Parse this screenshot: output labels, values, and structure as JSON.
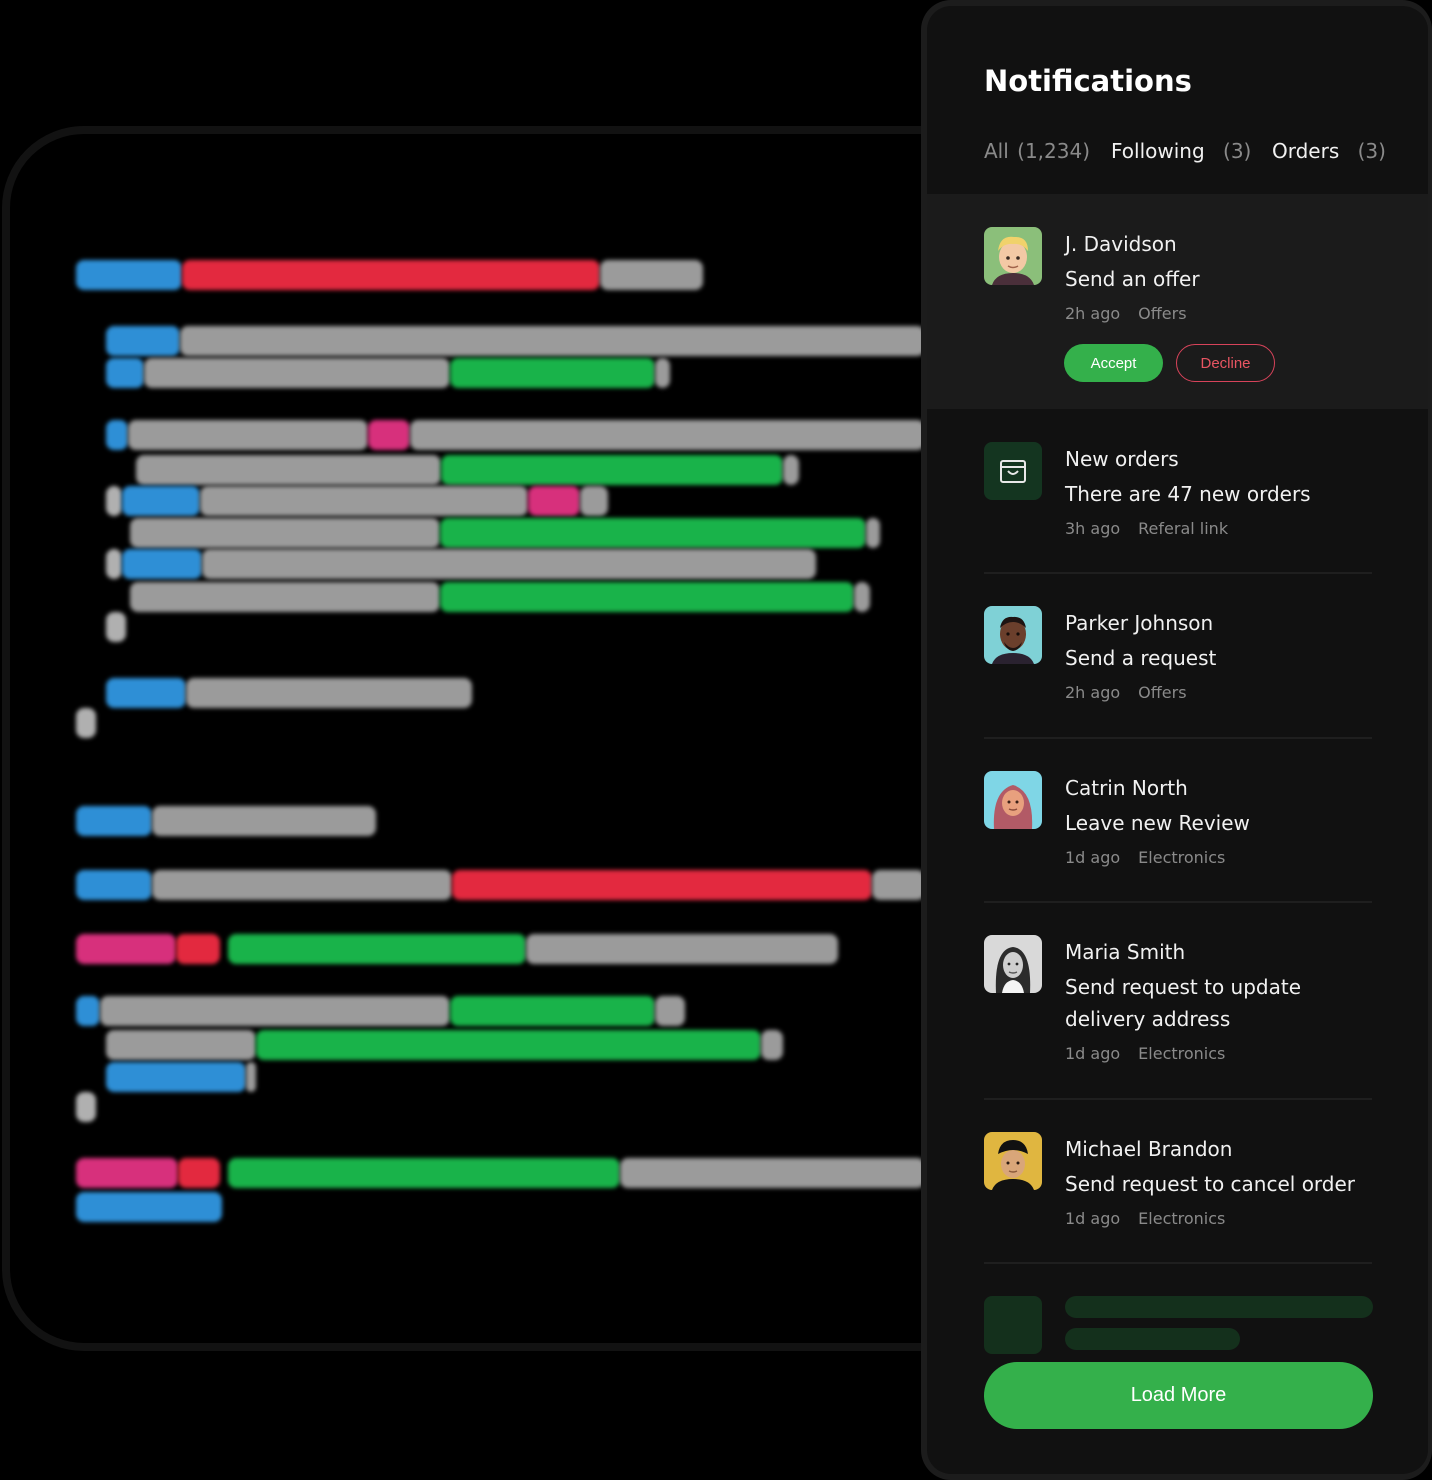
{
  "panel": {
    "title": "Notifications",
    "tabs": [
      {
        "label": "All",
        "count": "(1,234)"
      },
      {
        "label": "Following",
        "count": "(3)"
      },
      {
        "label": "Orders",
        "count": "(3)"
      }
    ]
  },
  "notifications": [
    {
      "name": "J. Davidson",
      "message": "Send an offer",
      "time": "2h ago",
      "category": "Offers",
      "accept_label": "Accept",
      "decline_label": "Decline"
    },
    {
      "name": "New orders",
      "message": "There are 47 new orders",
      "time": "3h ago",
      "category": "Referal link"
    },
    {
      "name": "Parker Johnson",
      "message": "Send a request",
      "time": "2h ago",
      "category": "Offers"
    },
    {
      "name": "Catrin North",
      "message": "Leave new Review",
      "time": "1d ago",
      "category": "Electronics"
    },
    {
      "name": "Maria Smith",
      "message": "Send request to update delivery address",
      "time": "1d ago",
      "category": "Electronics"
    },
    {
      "name": "Michael Brandon",
      "message": "Send request to cancel order",
      "time": "1d ago",
      "category": "Electronics"
    }
  ],
  "load_more_label": "Load More",
  "colors": {
    "accent": "#34b04b",
    "decline": "#e85562",
    "panel_bg": "#111111",
    "highlight_bg": "#1b1b1b"
  }
}
